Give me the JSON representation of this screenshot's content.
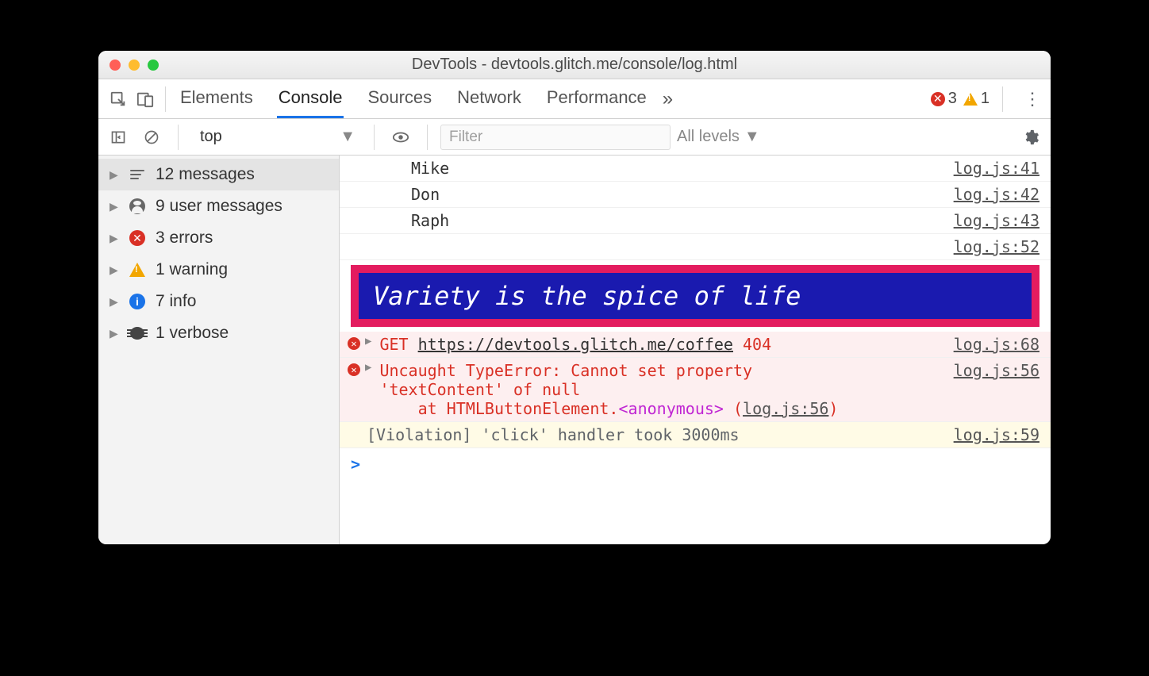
{
  "window": {
    "title": "DevTools - devtools.glitch.me/console/log.html"
  },
  "tabs": {
    "items": [
      "Elements",
      "Console",
      "Sources",
      "Network",
      "Performance"
    ],
    "activeIndex": 1,
    "moreGlyph": "»"
  },
  "counts": {
    "errors": "3",
    "warnings": "1"
  },
  "filter": {
    "context": "top",
    "placeholder": "Filter",
    "levels": "All levels"
  },
  "sidebar": {
    "items": [
      {
        "id": "messages",
        "label": "12 messages",
        "icon": "list",
        "selected": true
      },
      {
        "id": "user",
        "label": "9 user messages",
        "icon": "user"
      },
      {
        "id": "errors",
        "label": "3 errors",
        "icon": "error"
      },
      {
        "id": "warnings",
        "label": "1 warning",
        "icon": "warning"
      },
      {
        "id": "info",
        "label": "7 info",
        "icon": "info"
      },
      {
        "id": "verbose",
        "label": "1 verbose",
        "icon": "bug"
      }
    ]
  },
  "logs": {
    "rows": [
      {
        "kind": "plain",
        "msg": "Mike",
        "src": "log.js:41",
        "indent": true
      },
      {
        "kind": "plain",
        "msg": "Don",
        "src": "log.js:42",
        "indent": true
      },
      {
        "kind": "plain",
        "msg": "Raph",
        "src": "log.js:43",
        "indent": true
      },
      {
        "kind": "srcOnly",
        "src": "log.js:52"
      }
    ],
    "styled": {
      "text": "Variety is the spice of life"
    },
    "error404": {
      "method": "GET",
      "url": "https://devtools.glitch.me/coffee",
      "status": "404",
      "src": "log.js:68"
    },
    "uncaught": {
      "line1": "Uncaught TypeError: Cannot set property",
      "line2": "'textContent' of null",
      "traceLabel": "at HTMLButtonElement.",
      "anon": "<anonymous>",
      "traceLink": "log.js:56",
      "src": "log.js:56"
    },
    "violation": {
      "msg": "[Violation] 'click' handler took 3000ms",
      "src": "log.js:59"
    },
    "prompt": ">"
  }
}
